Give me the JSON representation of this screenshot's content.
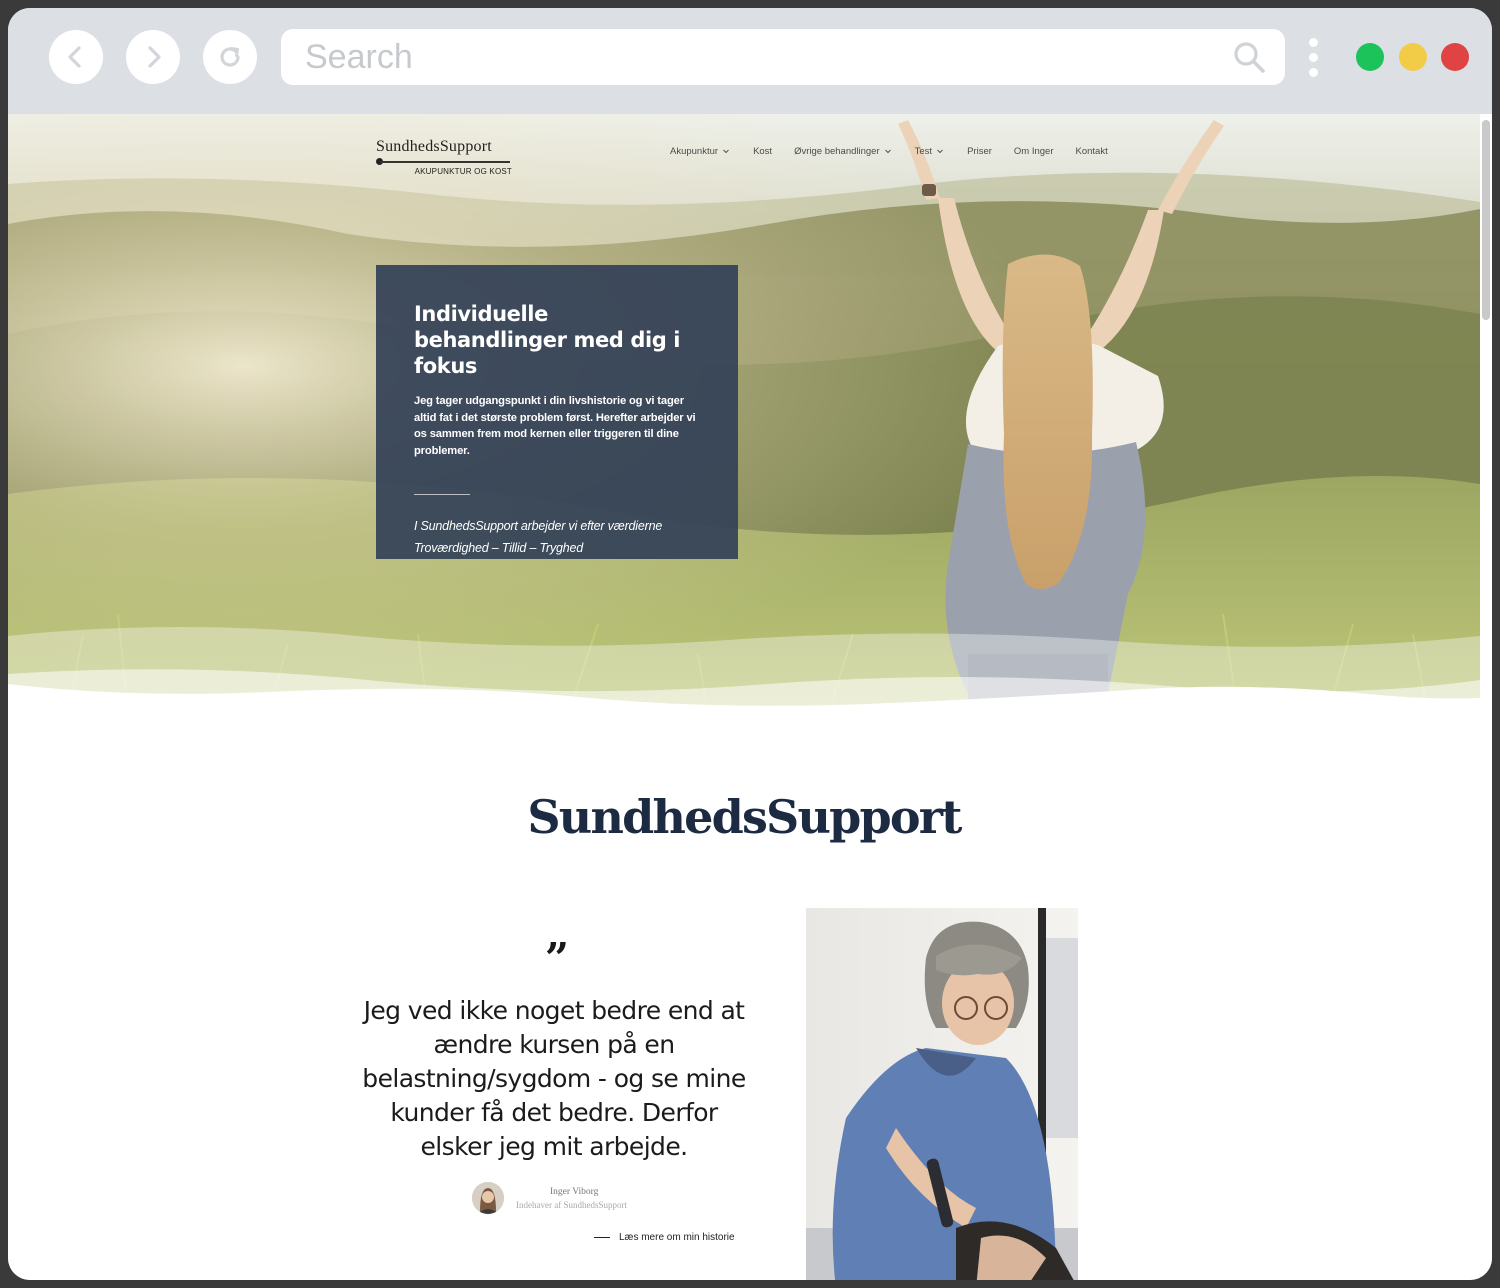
{
  "browser": {
    "search": {
      "placeholder": "Search"
    },
    "window_controls": {
      "green": "#1cc35a",
      "yellow": "#f2cc47",
      "red": "#df4343"
    }
  },
  "site": {
    "logo": {
      "name": "SundhedsSupport",
      "tagline": "AKUPUNKTUR OG KOST"
    },
    "nav": [
      {
        "label": "Akupunktur",
        "dropdown": true
      },
      {
        "label": "Kost",
        "dropdown": false
      },
      {
        "label": "Øvrige behandlinger",
        "dropdown": true
      },
      {
        "label": "Test",
        "dropdown": true
      },
      {
        "label": "Priser",
        "dropdown": false
      },
      {
        "label": "Om Inger",
        "dropdown": false
      },
      {
        "label": "Kontakt",
        "dropdown": false
      }
    ]
  },
  "hero": {
    "title": "Individuelle behandlinger med dig i fokus",
    "lead": "Jeg tager udgangspunkt i din livshistorie og vi tager altid fat i det største problem først. Herefter arbejder vi os sammen frem mod kernen eller triggeren til dine problemer.",
    "values_line1": "I SundhedsSupport arbejder vi efter værdierne",
    "values_line2": "Troværdighed – Tillid – Tryghed",
    "card_color": "#344257"
  },
  "about": {
    "heading": "SundhedsSupport",
    "quote_mark": "”",
    "quote": "Jeg ved ikke noget bedre end at ændre kursen på en belastning/sygdom - og se mine kunder få det bedre. Derfor elsker jeg mit arbejde.",
    "author_name": "Inger Viborg",
    "author_role": "Indehaver af SundhedsSupport",
    "read_more": "Læs mere om min historie",
    "heading_color": "#1c2a42"
  }
}
